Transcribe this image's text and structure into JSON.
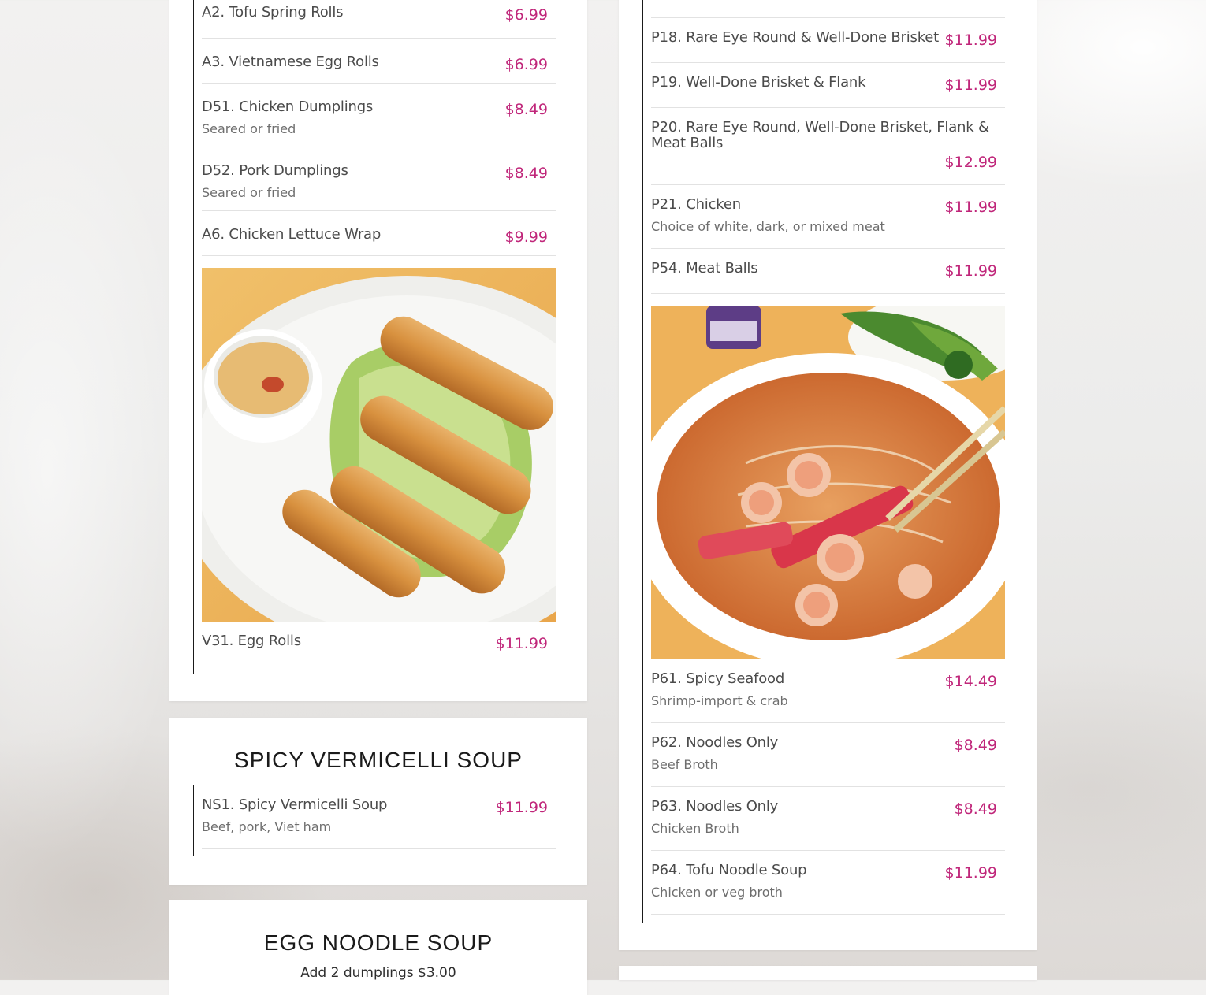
{
  "colors": {
    "price": "#c0267a",
    "text": "#4b4b4b",
    "desc": "#6e6e6e"
  },
  "left_menu": {
    "items": [
      {
        "name": "A2. Tofu Spring Rolls",
        "price": "$6.99",
        "desc": ""
      },
      {
        "name": "A3. Vietnamese Egg Rolls",
        "price": "$6.99",
        "desc": ""
      },
      {
        "name": "D51. Chicken Dumplings",
        "price": "$8.49",
        "desc": "Seared or fried"
      },
      {
        "name": "D52. Pork Dumplings",
        "price": "$8.49",
        "desc": "Seared or fried"
      },
      {
        "name": "A6. Chicken Lettuce Wrap",
        "price": "$9.99",
        "desc": ""
      }
    ],
    "photo_icon": "egg-rolls-photo",
    "featured": {
      "name": "V31. Egg Rolls",
      "price": "$11.99"
    }
  },
  "spicy_vermicelli": {
    "title": "SPICY VERMICELLI SOUP",
    "items": [
      {
        "name": "NS1. Spicy Vermicelli Soup",
        "price": "$11.99",
        "desc": "Beef, pork, Viet ham"
      }
    ]
  },
  "egg_noodle": {
    "title": "EGG NOODLE SOUP",
    "note": "Add 2 dumplings $3.00"
  },
  "right_menu": {
    "items": [
      {
        "name": "P18. Rare Eye Round & Well-Done Brisket",
        "price": "$11.99",
        "desc": ""
      },
      {
        "name": "P19. Well-Done Brisket & Flank",
        "price": "$11.99",
        "desc": ""
      },
      {
        "name": "P20. Rare Eye Round, Well-Done Brisket, Flank & Meat Balls",
        "price": "$12.99",
        "desc": ""
      },
      {
        "name": "P21. Chicken",
        "price": "$11.99",
        "desc": "Choice of white, dark, or mixed meat"
      },
      {
        "name": "P54. Meat Balls",
        "price": "$11.99",
        "desc": ""
      }
    ],
    "photo_icon": "seafood-pho-photo",
    "items_after": [
      {
        "name": "P61. Spicy Seafood",
        "price": "$14.49",
        "desc": "Shrimp-import & crab"
      },
      {
        "name": "P62. Noodles Only",
        "price": "$8.49",
        "desc": "Beef Broth"
      },
      {
        "name": "P63. Noodles Only",
        "price": "$8.49",
        "desc": "Chicken Broth"
      },
      {
        "name": "P64. Tofu Noodle Soup",
        "price": "$11.99",
        "desc": "Chicken or veg broth"
      }
    ]
  }
}
